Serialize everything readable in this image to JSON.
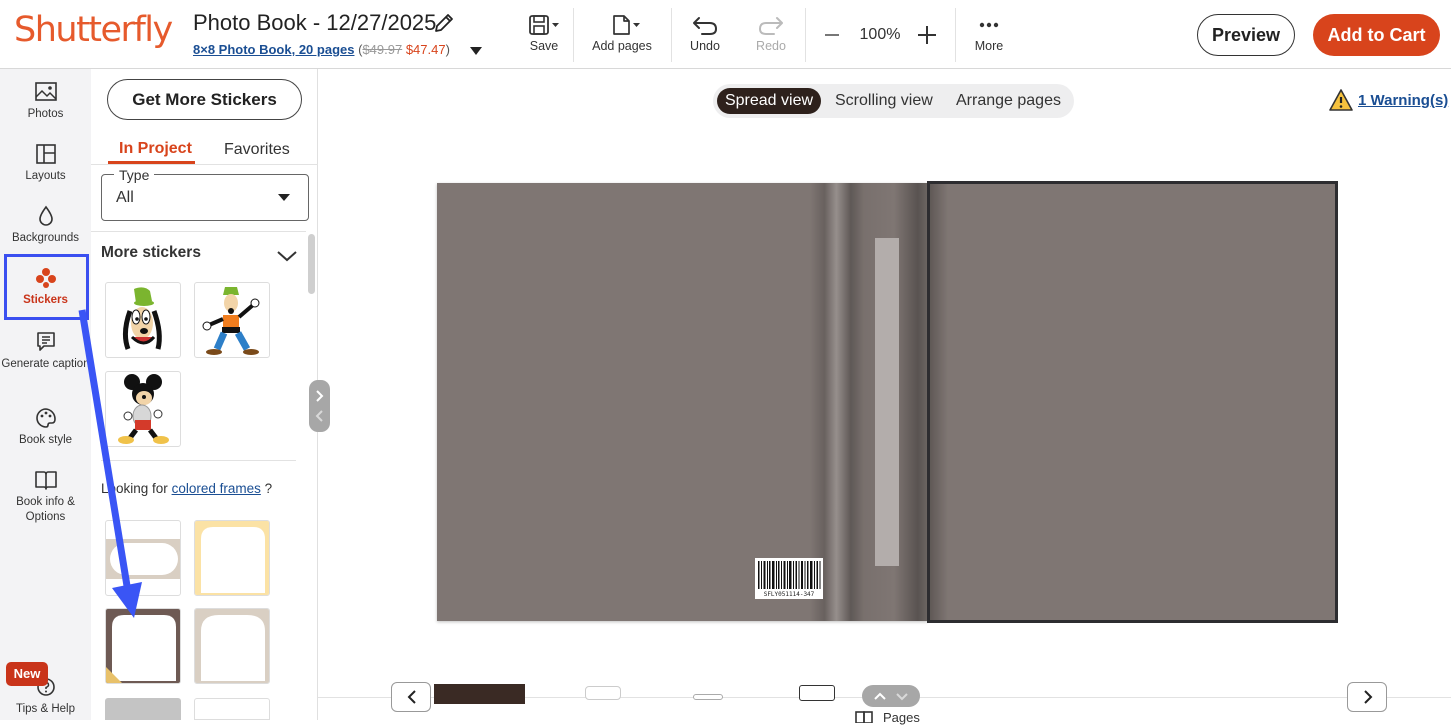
{
  "header": {
    "logo": "Shutterfly",
    "title": "Photo Book - 12/27/2025",
    "product_spec": "8×8 Photo Book, 20 pages",
    "price_open": "(",
    "old_price": "$49.97",
    "new_price": "$47.47",
    "price_close": ")",
    "tools": {
      "save": "Save",
      "add_pages": "Add pages",
      "undo": "Undo",
      "redo": "Redo",
      "more": "More"
    },
    "zoom": "100%",
    "preview": "Preview",
    "add_to_cart": "Add to Cart"
  },
  "rail": {
    "items": [
      {
        "label": "Photos"
      },
      {
        "label": "Layouts"
      },
      {
        "label": "Backgrounds"
      },
      {
        "label": "Stickers"
      },
      {
        "label": "Generate caption"
      },
      {
        "label": "Book style"
      },
      {
        "label": "Book info & Options"
      },
      {
        "label": "Tips & Help"
      }
    ],
    "new_badge": "New"
  },
  "panel": {
    "get_more": "Get More Stickers",
    "tabs": [
      "In Project",
      "Favorites"
    ],
    "type_label": "Type",
    "type_value": "All",
    "section_title": "More stickers",
    "frames_prefix": "Looking for",
    "frames_link": "colored frames",
    "frames_suffix": "?"
  },
  "canvas": {
    "views": [
      "Spread view",
      "Scrolling view",
      "Arrange pages"
    ],
    "warning": "1 Warning(s)",
    "barcode_number": "SFLY051114-347",
    "pages_label": "Pages"
  },
  "colors": {
    "brand": "#e65a2c",
    "accent": "#d8441c",
    "link": "#1a4e93",
    "highlight": "#3a4ff0",
    "cover": "#7f7673"
  }
}
